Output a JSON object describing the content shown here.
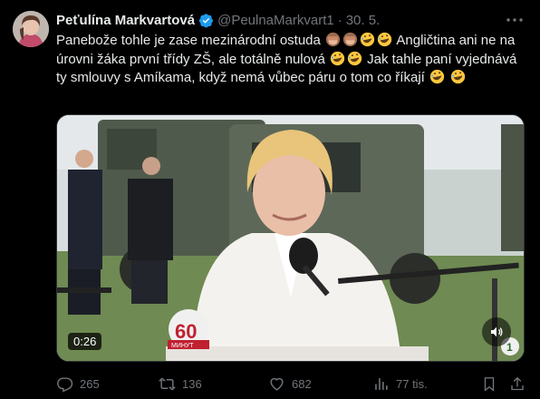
{
  "author": {
    "name": "Peťulína Markvartová",
    "handle": "@PeulnaMarkvart1",
    "date": "30. 5."
  },
  "tweet": {
    "part1": "Panebože tohle je zase mezinárodní ostuda",
    "part2": " Angličtina ani ne na úrovni žáka první třídy ZŠ, ale totálně nulová",
    "part3": " Jak tahle paní vyjednává ty smlouvy s Amíkama, když nemá vůbec páru o tom co říkají"
  },
  "video": {
    "duration": "0:26",
    "logo_text": "60",
    "logo_sub": "МИНУТ"
  },
  "stats": {
    "replies": "265",
    "reposts": "136",
    "likes": "682",
    "views": "77 tis."
  },
  "colors": {
    "background": "#000000",
    "text": "#e7e9ea",
    "muted": "#71767b",
    "verified": "#1d9bf0"
  },
  "icons": [
    "verified-badge-icon",
    "more-icon",
    "monkey-emoji",
    "rofl-emoji",
    "sound-icon",
    "reply-icon",
    "repost-icon",
    "like-icon",
    "views-icon",
    "bookmark-icon",
    "share-icon"
  ]
}
